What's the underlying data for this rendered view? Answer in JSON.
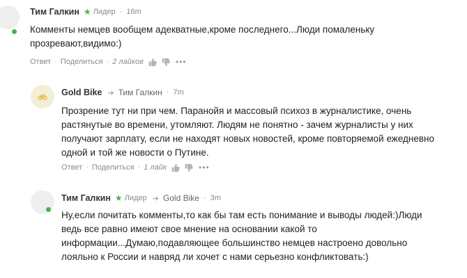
{
  "comments": [
    {
      "author": "Тим Галкин",
      "badge": "Лидер",
      "time": "16m",
      "lines": [
        "Комменты немцев вообщем адекватные,кроме последнего...Люди помаленьку",
        "прозревают,видимо:)"
      ],
      "actions": {
        "reply": "Ответ",
        "share": "Поделиться",
        "likes": "2 лайков"
      }
    },
    {
      "author": "Gold Bike",
      "reply_to": "Тим Галкин",
      "time": "7m",
      "lines": [
        "Прозрение тут ни при чем. Паранойя и массовый психоз в журналистике, очень",
        "растянутые во времени, утомляют. Людям не понятно - зачем журналисты у них",
        "получают зарплату, если не находят новых новостей, кроме повторяемой ежедневно",
        "одной и той же новости о Путине."
      ],
      "actions": {
        "reply": "Ответ",
        "share": "Поделиться",
        "likes": "1 лайк"
      }
    },
    {
      "author": "Тим Галкин",
      "badge": "Лидер",
      "reply_to": "Gold Bike",
      "time": "3m",
      "lines": [
        "Ну,если почитать комменты,то как бы там есть понимание и выводы людей:)Люди",
        "ведь все равно имеют свое мнение на основании какой то",
        "информации...Думаю,подавляющее большинство немцев настроено довольно",
        "лояльно к России и навряд ли хочет с нами серьезно конфликтовать:)"
      ]
    }
  ],
  "colors": {
    "online": "#4caf50",
    "badge": "#4caf50",
    "muted": "#888888"
  },
  "icons": [
    "leader-star-icon",
    "reply-arrow-icon",
    "thumbs-up-icon",
    "thumbs-down-icon",
    "more-dots-icon",
    "bicycle-icon"
  ]
}
